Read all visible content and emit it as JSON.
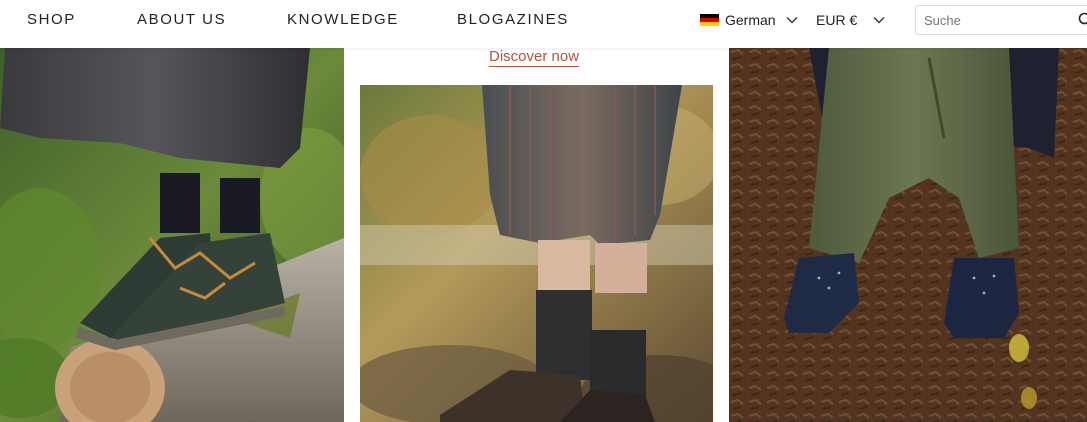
{
  "nav": {
    "items": [
      "SHOP",
      "ABOUT US",
      "KNOWLEDGE",
      "BLOGAZINES"
    ]
  },
  "language": {
    "label": "German",
    "flag_icon": "germany-flag-icon"
  },
  "currency": {
    "label": "EUR €"
  },
  "search": {
    "placeholder": "Suche",
    "value": ""
  },
  "promo": {
    "link_label": "Discover now"
  },
  "colors": {
    "link": "#b4533a",
    "text": "#222222",
    "background": "#ffffff"
  },
  "images": [
    {
      "name": "forest-boots-photo"
    },
    {
      "name": "child-socks-shoes-photo"
    },
    {
      "name": "toddler-navy-shoes-photo"
    }
  ]
}
